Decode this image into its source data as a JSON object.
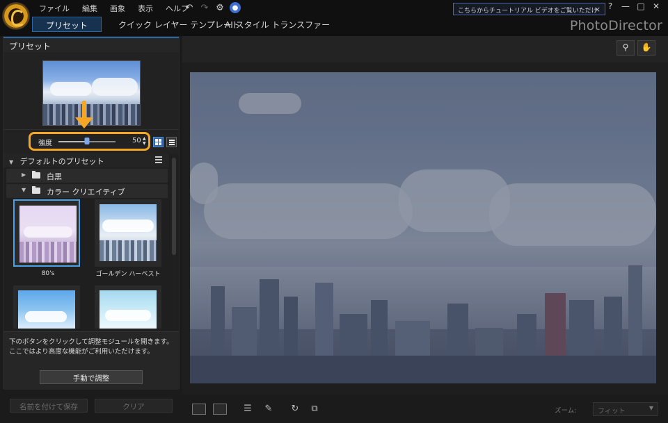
{
  "menu": [
    "ファイル",
    "編集",
    "画象",
    "表示",
    "ヘルプ"
  ],
  "tutorial_text": "こちらからチュートリアル ビデオをご覧いただけます。",
  "tutorial_close": "×",
  "window_controls": [
    "?",
    "—",
    "□",
    "✕"
  ],
  "tabs": [
    "プリセット",
    "クイック レイヤー テンプレート",
    "AI スタイル トランスファー"
  ],
  "brand": "PhotoDirector",
  "panel_title": "プリセット",
  "strength": {
    "label": "強度",
    "value": "50",
    "level_percent": 50
  },
  "tree": {
    "title": "デフォルトのプリセット",
    "items": [
      {
        "label": "白黒",
        "expanded": false
      },
      {
        "label": "カラー クリエイティブ",
        "expanded": true
      }
    ]
  },
  "presets": [
    {
      "name": "80's",
      "selected": true,
      "tint": "#d9c6ea"
    },
    {
      "name": "ゴールデン ハーベスト",
      "selected": false,
      "tint": "#bcd6ec"
    },
    {
      "name": "",
      "selected": false,
      "tint": "#8fc0ea"
    },
    {
      "name": "",
      "selected": false,
      "tint": "#b9dff2"
    }
  ],
  "info_text": "下のボタンをクリックして調整モジュールを開きます。ここではより高度な機能がご利用いただけます。",
  "manual_button": "手動で調整",
  "save_button": "名前を付けて保存",
  "clear_button": "クリア",
  "zoom_label": "ズーム:",
  "zoom_value": "フィット",
  "colors": {
    "accent": "#2e66a5",
    "highlight": "#f5a623",
    "selection": "#4aa3e8"
  },
  "icons": [
    "app-logo-icon",
    "undo-icon",
    "redo-icon",
    "settings-icon",
    "notification-icon",
    "zoom-tool-icon",
    "hand-tool-icon",
    "single-view-icon",
    "compare-view-icon",
    "adjust-panel-icon",
    "brush-icon",
    "rotate-icon",
    "crop-icon"
  ]
}
